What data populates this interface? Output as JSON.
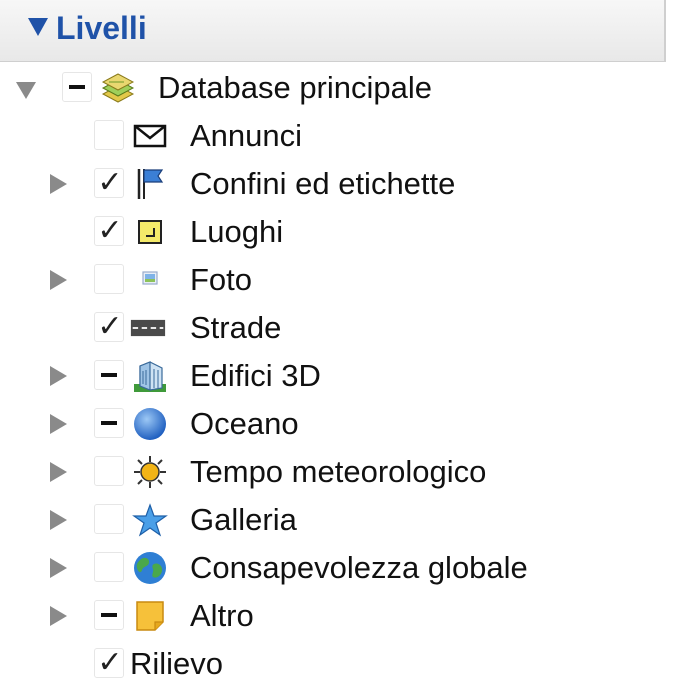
{
  "panel": {
    "title": "Livelli"
  },
  "tree": {
    "root_label": "Database principale",
    "items": [
      {
        "label": "Annunci",
        "icon": "envelope-icon",
        "checked": false
      },
      {
        "label": "Confini ed etichette",
        "icon": "flag-icon",
        "checked": true
      },
      {
        "label": "Luoghi",
        "icon": "place-square-icon",
        "checked": true
      },
      {
        "label": "Foto",
        "icon": "photo-icon",
        "checked": false
      },
      {
        "label": "Strade",
        "icon": "road-icon",
        "checked": true
      },
      {
        "label": "Edifici 3D",
        "icon": "building-3d-icon",
        "checked": "partial"
      },
      {
        "label": "Oceano",
        "icon": "ocean-globe-icon",
        "checked": "partial"
      },
      {
        "label": "Tempo meteorologico",
        "icon": "sun-weather-icon",
        "checked": false
      },
      {
        "label": "Galleria",
        "icon": "star-gallery-icon",
        "checked": false
      },
      {
        "label": "Consapevolezza globale",
        "icon": "earth-globe-icon",
        "checked": false
      },
      {
        "label": "Altro",
        "icon": "sticky-note-icon",
        "checked": "partial"
      },
      {
        "label": "Rilievo",
        "icon": "",
        "checked": true
      }
    ]
  },
  "colors": {
    "accent": "#1f52a8",
    "disclosure": "#8a8a8a"
  }
}
